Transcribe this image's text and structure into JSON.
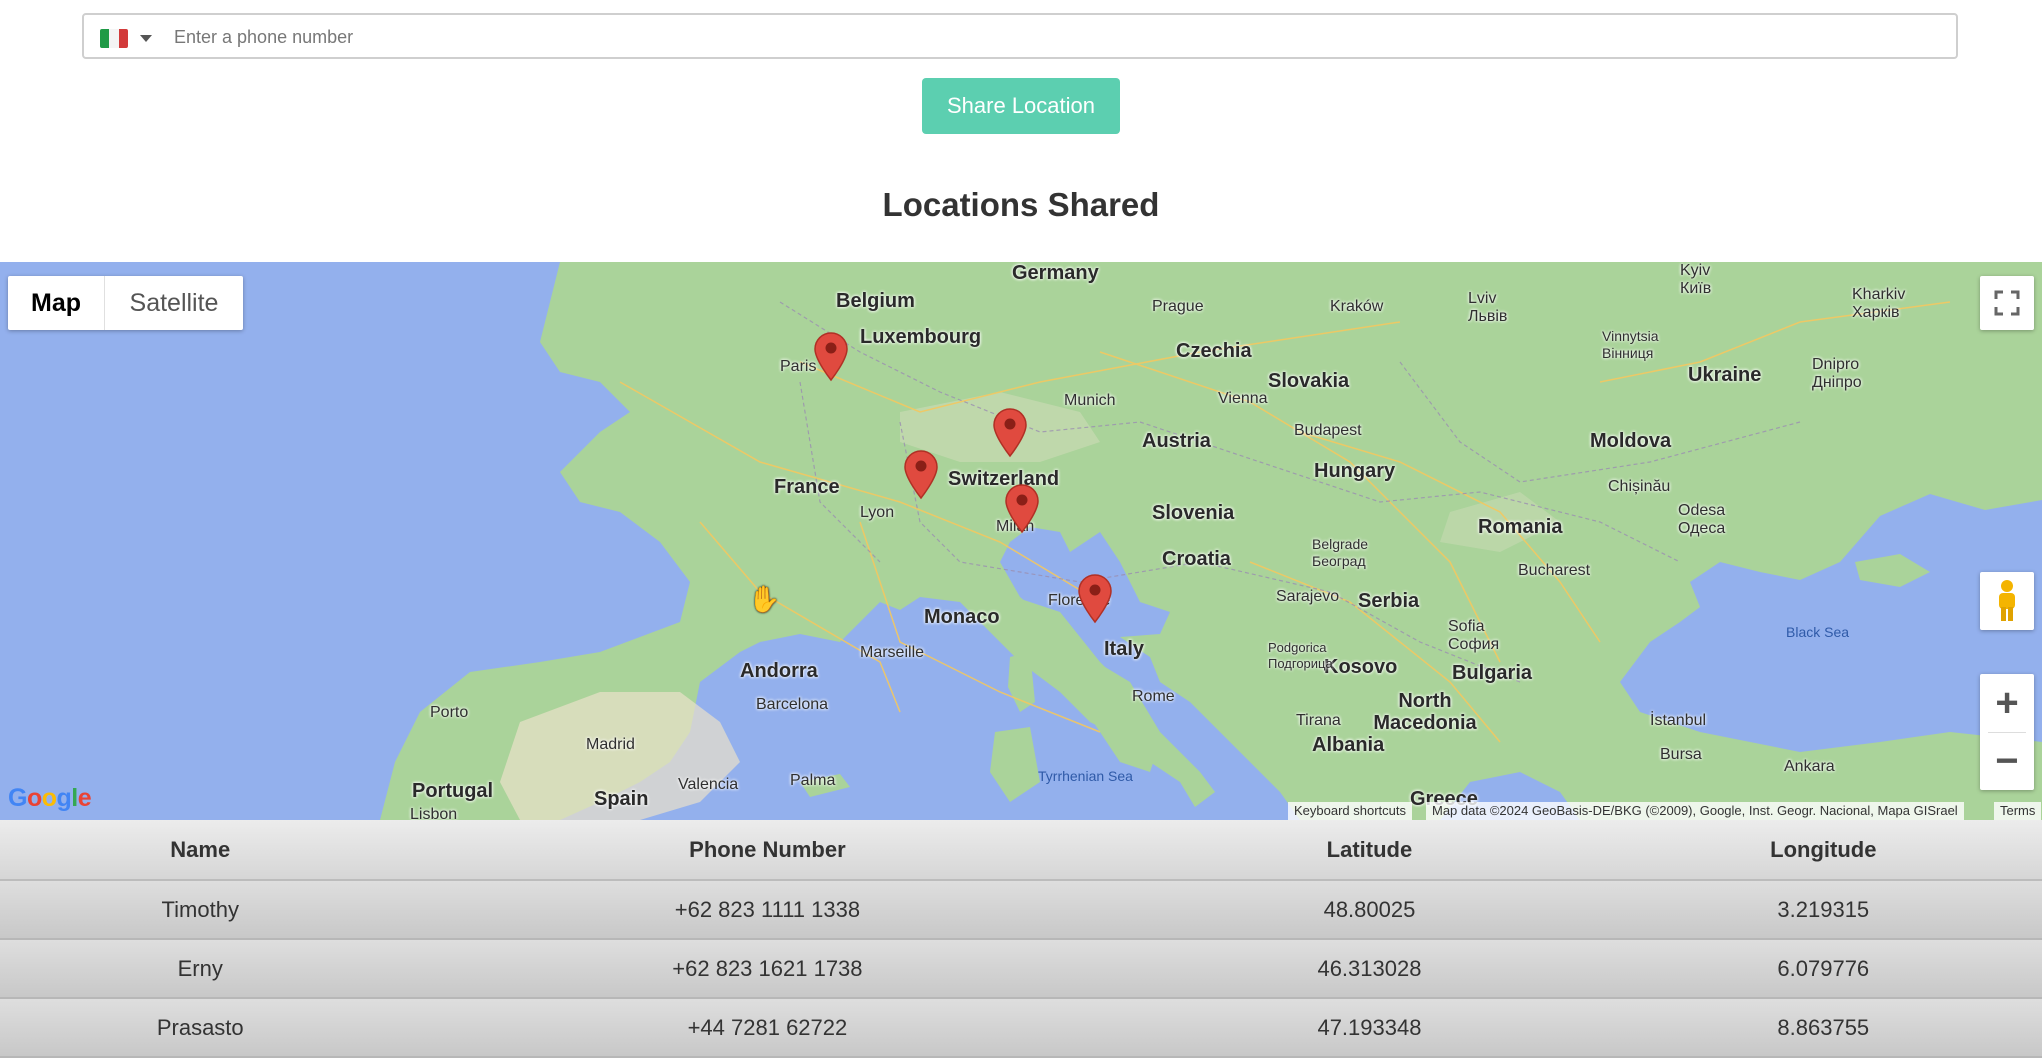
{
  "phone": {
    "country_flag": "italy-flag-icon",
    "placeholder": "Enter a phone number",
    "value": ""
  },
  "share_button": "Share Location",
  "section_title": "Locations Shared",
  "map": {
    "type_buttons": {
      "map": "Map",
      "satellite": "Satellite",
      "selected": "Map"
    },
    "labels": {
      "countries": [
        "Germany",
        "Belgium",
        "Luxembourg",
        "Czechia",
        "Slovakia",
        "Austria",
        "Hungary",
        "Ukraine",
        "Moldova",
        "Switzerland",
        "France",
        "Slovenia",
        "Croatia",
        "Romania",
        "Serbia",
        "Monaco",
        "Italy",
        "Andorra",
        "Kosovo",
        "Bulgaria",
        "North Macedonia",
        "Albania",
        "Portugal",
        "Spain",
        "Greece"
      ],
      "cities": [
        "Paris",
        "Prague",
        "Kraków",
        "Lviv Львів",
        "Kyiv Київ",
        "Kharkiv Харків",
        "Vinnytsia Вінниця",
        "Dnipro Дніпро",
        "Munich",
        "Vienna",
        "Budapest",
        "Chișinău",
        "Odesa Одеса",
        "Lyon",
        "Milan",
        "Belgrade Београд",
        "Bucharest",
        "Sarajevo",
        "Florence",
        "Sofia София",
        "Marseille",
        "Podgorica Подгорица",
        "Barcelona",
        "Rome",
        "Tirana",
        "İstanbul",
        "Porto",
        "Madrid",
        "Valencia",
        "Palma",
        "Bursa",
        "Ankara",
        "Lisbon"
      ],
      "seas": [
        "Black Sea",
        "Tyrrhenian Sea"
      ]
    },
    "google_logo": [
      "G",
      "o",
      "o",
      "g",
      "l",
      "e"
    ],
    "attribution": {
      "shortcuts": "Keyboard shortcuts",
      "data": "Map data ©2024 GeoBasis-DE/BKG (©2009), Google, Inst. Geogr. Nacional, Mapa GISrael",
      "terms": "Terms"
    },
    "markers": [
      "paris-marker",
      "zurich-marker",
      "geneva-marker",
      "milan-marker",
      "florence-marker"
    ],
    "colors": {
      "water": "#93b0ed",
      "land": "#aad39a",
      "marker": "#e04a3f"
    }
  },
  "table": {
    "headers": [
      "Name",
      "Phone Number",
      "Latitude",
      "Longitude"
    ],
    "rows": [
      {
        "name": "Timothy",
        "phone": "+62 823 1111 1338",
        "lat": "48.80025",
        "lng": "3.219315"
      },
      {
        "name": "Erny",
        "phone": "+62 823 1621 1738",
        "lat": "46.313028",
        "lng": "6.079776"
      },
      {
        "name": "Prasasto",
        "phone": "+44 7281 62722",
        "lat": "47.193348",
        "lng": "8.863755"
      }
    ]
  },
  "accent_color": "#5ccfb0"
}
